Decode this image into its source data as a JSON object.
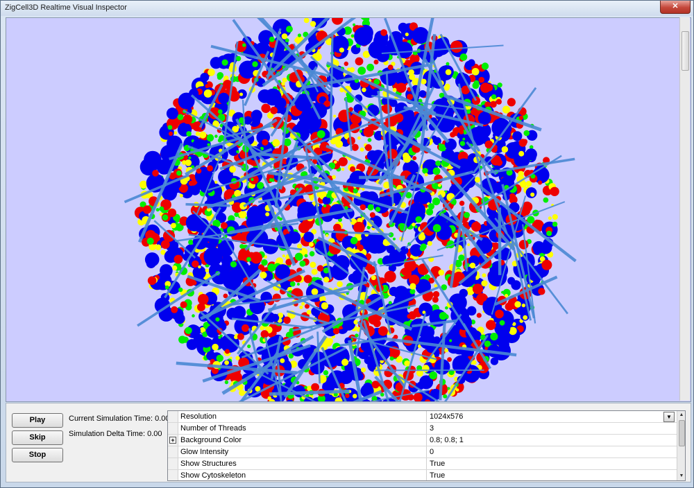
{
  "window": {
    "title": "ZigCell3D Realtime Visual Inspector",
    "close_label": "✕"
  },
  "viewport": {
    "background_color": "#ccccff",
    "particle_colors": [
      "#0000ee",
      "#ee0000",
      "#00ee00",
      "#ffff00"
    ],
    "filament_color": "#4a88d4"
  },
  "controls": {
    "play_label": "Play",
    "skip_label": "Skip",
    "stop_label": "Stop",
    "current_time_label": "Current Simulation Time: 0.00",
    "delta_time_label": "Simulation Delta Time: 0.00"
  },
  "properties": [
    {
      "name": "Resolution",
      "value": "1024x576",
      "dropdown": true
    },
    {
      "name": "Number of Threads",
      "value": "3"
    },
    {
      "name": "Background Color",
      "value": "0.8; 0.8; 1",
      "expandable": true
    },
    {
      "name": "Glow Intensity",
      "value": "0"
    },
    {
      "name": "Show Structures",
      "value": "True"
    },
    {
      "name": "Show Cytoskeleton",
      "value": "True"
    }
  ]
}
